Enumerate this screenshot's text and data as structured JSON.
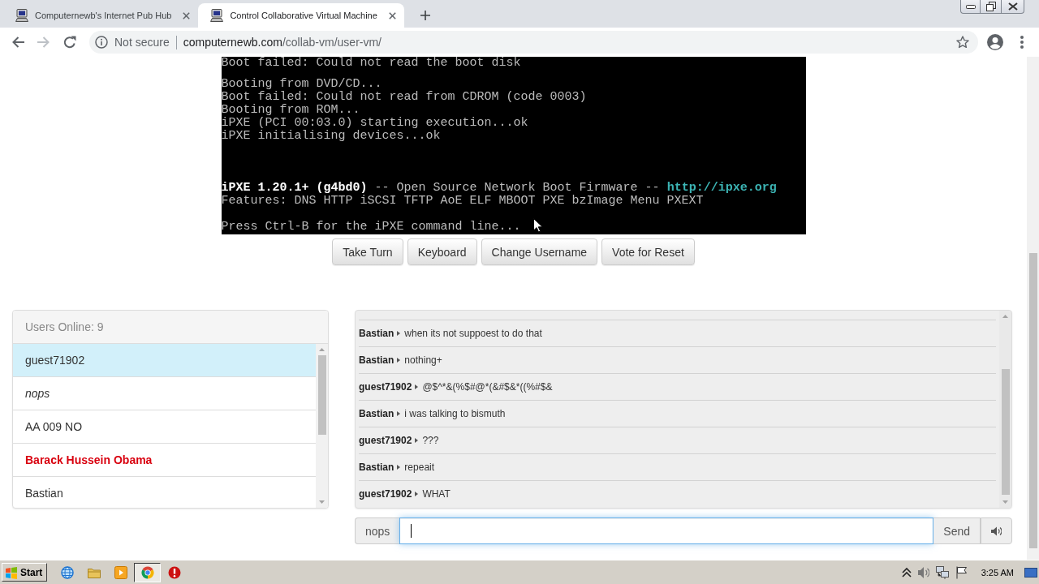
{
  "browser": {
    "tabs": [
      {
        "title": "Computernewb's Internet Pub Hub",
        "selected": false
      },
      {
        "title": "Control Collaborative Virtual Machine",
        "selected": true
      }
    ],
    "nav": [
      {
        "kind": "back",
        "disabled": false
      },
      {
        "kind": "forward",
        "disabled": true
      },
      {
        "kind": "reload",
        "disabled": false
      }
    ],
    "address": {
      "security": "Not secure",
      "host": "computernewb.com",
      "path": "/collab-vm/user-vm/"
    }
  },
  "vm_screen": {
    "blocks": [
      [
        [
          {
            "text": "Boot failed: Could not read the boot disk",
            "kind": "normal"
          }
        ]
      ],
      [
        [
          {
            "text": "Booting from DVD/CD...",
            "kind": "normal"
          }
        ],
        [
          {
            "text": "Boot failed: Could not read from CDROM (code 0003)",
            "kind": "normal"
          }
        ],
        [
          {
            "text": "Booting from ROM...",
            "kind": "normal"
          }
        ],
        [
          {
            "text": "iPXE (PCI 00:03.0) starting execution...ok",
            "kind": "normal"
          }
        ],
        [
          {
            "text": "iPXE initialising devices...ok",
            "kind": "normal"
          }
        ]
      ],
      [
        [
          {
            "text": "iPXE 1.20.1+ (g4bd0)",
            "kind": "bright"
          },
          {
            "text": "-- Open Source Network Boot Firmware --",
            "kind": "normal"
          },
          {
            "text": "http://ipxe.org",
            "kind": "link"
          }
        ],
        [
          {
            "text": "Features: DNS HTTP iSCSI TFTP AoE ELF MBOOT PXE bzImage Menu PXEXT",
            "kind": "normal"
          }
        ]
      ],
      [
        [
          {
            "text": "Press Ctrl-B for the iPXE command line...",
            "kind": "normal"
          }
        ]
      ]
    ]
  },
  "vm_buttons": [
    "Take Turn",
    "Keyboard",
    "Change Username",
    "Vote for Reset"
  ],
  "users": {
    "heading": "Users Online: 9",
    "items": [
      {
        "name": "guest71902",
        "kind": "turn"
      },
      {
        "name": "nops",
        "kind": "self"
      },
      {
        "name": "AA 009 NO",
        "kind": "user"
      },
      {
        "name": "Barack Hussein Obama",
        "kind": "admin"
      },
      {
        "name": "Bastian",
        "kind": "user"
      }
    ]
  },
  "chat": {
    "messages": [
      {
        "user": "Bastian",
        "text": "when its not suppoest to do that"
      },
      {
        "user": "Bastian",
        "text": "nothing+"
      },
      {
        "user": "guest71902",
        "text": "@$^*&(%$#@*(&#$&*((%#$&"
      },
      {
        "user": "Bastian",
        "text": "i was talking to bismuth"
      },
      {
        "user": "guest71902",
        "text": "???"
      },
      {
        "user": "Bastian",
        "text": "repeait"
      },
      {
        "user": "guest71902",
        "text": "WHAT"
      }
    ],
    "username": "nops",
    "send": "Send"
  },
  "taskbar": {
    "start": "Start",
    "apps": [
      {
        "kind": "globe",
        "selected": false
      },
      {
        "kind": "folder",
        "selected": false
      },
      {
        "kind": "play",
        "selected": false
      },
      {
        "kind": "wheel",
        "selected": true
      },
      {
        "kind": "alert",
        "selected": false
      }
    ],
    "clock": "3:25 AM"
  }
}
